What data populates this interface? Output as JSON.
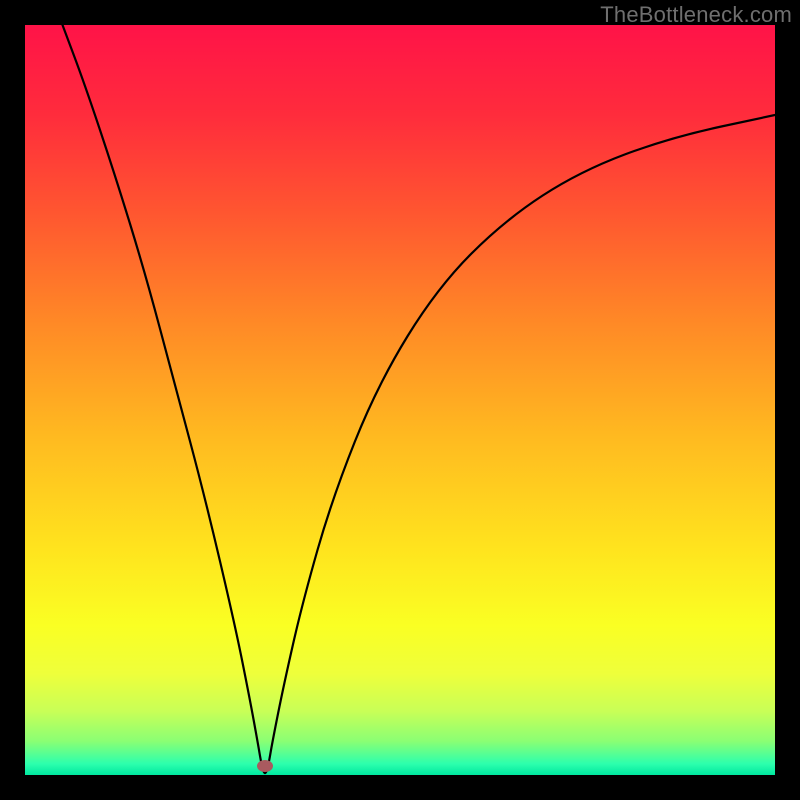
{
  "watermark": "TheBottleneck.com",
  "colors": {
    "frame": "#000000",
    "marker": "#a95a5f",
    "gradient_stops": [
      {
        "offset": 0.0,
        "color": "#ff1348"
      },
      {
        "offset": 0.12,
        "color": "#ff2c3c"
      },
      {
        "offset": 0.25,
        "color": "#ff5630"
      },
      {
        "offset": 0.4,
        "color": "#ff8a26"
      },
      {
        "offset": 0.55,
        "color": "#ffba20"
      },
      {
        "offset": 0.7,
        "color": "#ffe41e"
      },
      {
        "offset": 0.8,
        "color": "#faff23"
      },
      {
        "offset": 0.865,
        "color": "#eeff3b"
      },
      {
        "offset": 0.915,
        "color": "#c8ff57"
      },
      {
        "offset": 0.955,
        "color": "#8aff74"
      },
      {
        "offset": 0.985,
        "color": "#2dffad"
      },
      {
        "offset": 1.0,
        "color": "#00e8a0"
      }
    ]
  },
  "chart_data": {
    "type": "line",
    "title": "",
    "xlabel": "",
    "ylabel": "",
    "x_range": [
      0,
      100
    ],
    "y_range": [
      0,
      100
    ],
    "notch_x": 32,
    "marker": {
      "x": 32,
      "y": 1.2
    },
    "series": [
      {
        "name": "curve",
        "points": [
          {
            "x": 5.0,
            "y": 100.0
          },
          {
            "x": 8.0,
            "y": 92.0
          },
          {
            "x": 12.0,
            "y": 80.0
          },
          {
            "x": 16.0,
            "y": 67.0
          },
          {
            "x": 20.0,
            "y": 52.0
          },
          {
            "x": 24.0,
            "y": 37.0
          },
          {
            "x": 28.0,
            "y": 20.0
          },
          {
            "x": 30.0,
            "y": 10.0
          },
          {
            "x": 31.0,
            "y": 4.5
          },
          {
            "x": 31.6,
            "y": 1.0
          },
          {
            "x": 32.0,
            "y": 0.0
          },
          {
            "x": 32.4,
            "y": 1.0
          },
          {
            "x": 33.0,
            "y": 4.5
          },
          {
            "x": 34.5,
            "y": 12.0
          },
          {
            "x": 37.0,
            "y": 23.0
          },
          {
            "x": 41.0,
            "y": 37.0
          },
          {
            "x": 47.0,
            "y": 52.0
          },
          {
            "x": 55.0,
            "y": 65.0
          },
          {
            "x": 64.0,
            "y": 74.0
          },
          {
            "x": 74.0,
            "y": 80.5
          },
          {
            "x": 86.0,
            "y": 85.0
          },
          {
            "x": 100.0,
            "y": 88.0
          }
        ]
      }
    ]
  }
}
